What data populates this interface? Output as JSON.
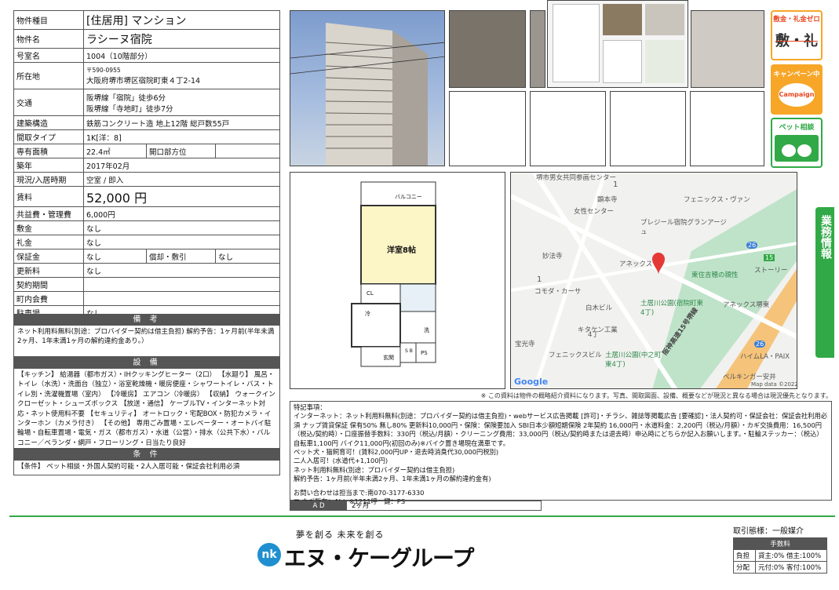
{
  "spec": {
    "property_type": {
      "label": "物件種目",
      "value": "[住居用] マンション"
    },
    "name": {
      "label": "物件名",
      "value": "ラシーヌ宿院"
    },
    "room_no": {
      "label": "号室名",
      "value": "1004（10階部分）"
    },
    "address": {
      "label": "所在地",
      "zip": "〒590-0955",
      "value": "大阪府堺市堺区宿院町東４丁2-14"
    },
    "traffic": {
      "label": "交通",
      "line1": "阪堺線「宿院」徒歩6分",
      "line2": "阪堺線「寺地町」徒歩7分"
    },
    "structure": {
      "label": "建築構造",
      "value": "鉄筋コンクリート造 地上12階 総戸数55戸"
    },
    "layout": {
      "label": "間取タイプ",
      "value": "1K[洋：8]"
    },
    "area": {
      "label": "専有面積",
      "value": "22.4㎡",
      "sub_label": "開口部方位",
      "sub_value": ""
    },
    "built": {
      "label": "築年",
      "value": "2017年02月"
    },
    "status": {
      "label": "現況/入居時期",
      "value": "空室 / 即入"
    },
    "rent": {
      "label": "賃料",
      "value": "52,000 円"
    },
    "common_fee": {
      "label": "共益費・管理費",
      "value": "6,000円"
    },
    "shikikin": {
      "label": "敷金",
      "value": "なし"
    },
    "reikin": {
      "label": "礼金",
      "value": "なし"
    },
    "deposit": {
      "label": "保証金",
      "value": "なし",
      "sub_label": "償却・敷引",
      "sub_value": "なし"
    },
    "renewal": {
      "label": "更新料",
      "value": "なし"
    },
    "contract_period": {
      "label": "契約期間",
      "value": ""
    },
    "town_fee": {
      "label": "町内会費",
      "value": ""
    },
    "parking": {
      "label": "駐車場",
      "value": "なし"
    }
  },
  "remarks": {
    "title": "備 考",
    "text": "ネット利用料無料(別途：プロバイダー契約は借主負担) 解約予告：1ヶ月前(半年未満2ヶ月、1年未満1ヶ月の解約違約金あり。）"
  },
  "facilities": {
    "title": "設 備",
    "text": "【キッチン】 給湯器（都市ガス）・IHクッキングヒーター（2口） 【水廻り】 風呂・トイレ（水洗）・洗面台（独立）・浴室乾燥機・暖房便座・シャワートイレ・バス・トイレ別・洗濯機置場（室内） 【冷暖房】 エアコン（冷暖房） 【収納】 ウォークインクローゼット・シューズボックス 【放送・通信】 ケーブルTV・インターネット対応・ネット使用料不要 【セキュリティ】 オートロック・宅配BOX・防犯カメラ・インターホン（カメラ付き） 【その他】 専用ごみ置場・エレベーター・オートバイ駐輪場・自転車置場・電気・ガス（都市ガス）・水道（公営）・排水（公共下水）・バルコニー／ベランダ・網戸・フローリング・日当たり良好"
  },
  "conditions": {
    "title": "条 件",
    "text": "【条件】 ペット相談・外国人契約可能・2人入居可能・保証会社利用必須"
  },
  "badges": {
    "zero": "敷金・礼金ゼロ",
    "campaign": "キャンペーン中",
    "campaign_sub": "Campaign",
    "pet": "ペット相談"
  },
  "side_tab": "業務情報",
  "floorplan": {
    "balcony": "バルコニー",
    "room": "洋室8帖",
    "cl": "CL",
    "fridge": "冷",
    "wash": "洗",
    "entrance": "玄関",
    "shoes": "S B",
    "ps": "PS"
  },
  "map": {
    "labels": [
      "堺市男女共同参画センター",
      "顕本寺",
      "女性センター",
      "フェニックス・ヴァン",
      "プレジール宿院グランアージュ",
      "妙法寺",
      "アネックス",
      "東住吉穂の親性",
      "ストーリー",
      "コモダ・カーサ",
      "白木ビル",
      "土居川公園(宿院町東4丁)",
      "キタケン工業",
      "アネックス堺東",
      "宝光寺",
      "4丁",
      "フェニックスビル",
      "土居川公園(中之町東4丁)",
      "阪神高速15号堺線",
      "ハイムLA・PAIX",
      "ベルキンガー安井"
    ],
    "nums": [
      "1",
      "1",
      "15",
      "26",
      "26"
    ],
    "google": "Google",
    "credit": "Map data ©2022"
  },
  "disclaimer": "※ この資料は物件の概略紹介資料になります。写真、間取図面、設備、概要などが現況と異なる場合は現況優先となります。",
  "notes": {
    "title": "特記事項：",
    "lines": [
      "インターネット：ネット利用料無料(別途：プロバイダー契約は借主負担)・webサービス広告掲載 [許可]・チラシ、雑誌等掲載広告 [要確認]・法人契約可・保証会社：保証会社利用必須 ナップ賃貸保証 保有50% 無し80% 更新料10,000円・保険：保険要加入 SBI日本少額短期保険 2年契約 16,000円・水道料金：2,200円（税込/月額）・カギ交換費用：16,500円（税込/契約時）・口座振替手数料：330円（税込/月額）・クリーニング費用：33,000円（税込/契約時または退去時）申込時にどちらか記入お願いします。・駐輪ステッカー：（税込）自転車1,100円 バイク11,000円(初回のみ)※バイク置き場現在満車です。",
      "ペット犬・猫飼育可！(賃料2,000円UP・退去時消臭代30,000円税別)",
      "二人入居可！(水道代+1,100円)",
      "ネット利用料無料(別途：プロバイダー契約は借主負担)",
      "解約予告：1ヶ月前(半年未満2ヶ月、1年未満1ヶ月の解約違約金有)",
      "",
      "お問い合わせは担当まで:南070-3177-6330",
      "■ カギ所在：AL：※1211呼　鍵：PS"
    ]
  },
  "ad": {
    "label": "A D",
    "value": "2ヶ月"
  },
  "logo": {
    "slogan": "夢を創る 未来を創る",
    "mark": "nk",
    "word": "エヌ・ケーグループ"
  },
  "fee": {
    "title": "取引態様：一般媒介",
    "header": "手数料",
    "burden_label": "負担",
    "burden_value": "貸主:0% 借主:100%",
    "split_label": "分配",
    "split_value": "元付:0% 客付:100%"
  },
  "colors": {
    "accent_green": "#31a947",
    "dark": "#555555",
    "badge_orange": "#f7a628"
  }
}
